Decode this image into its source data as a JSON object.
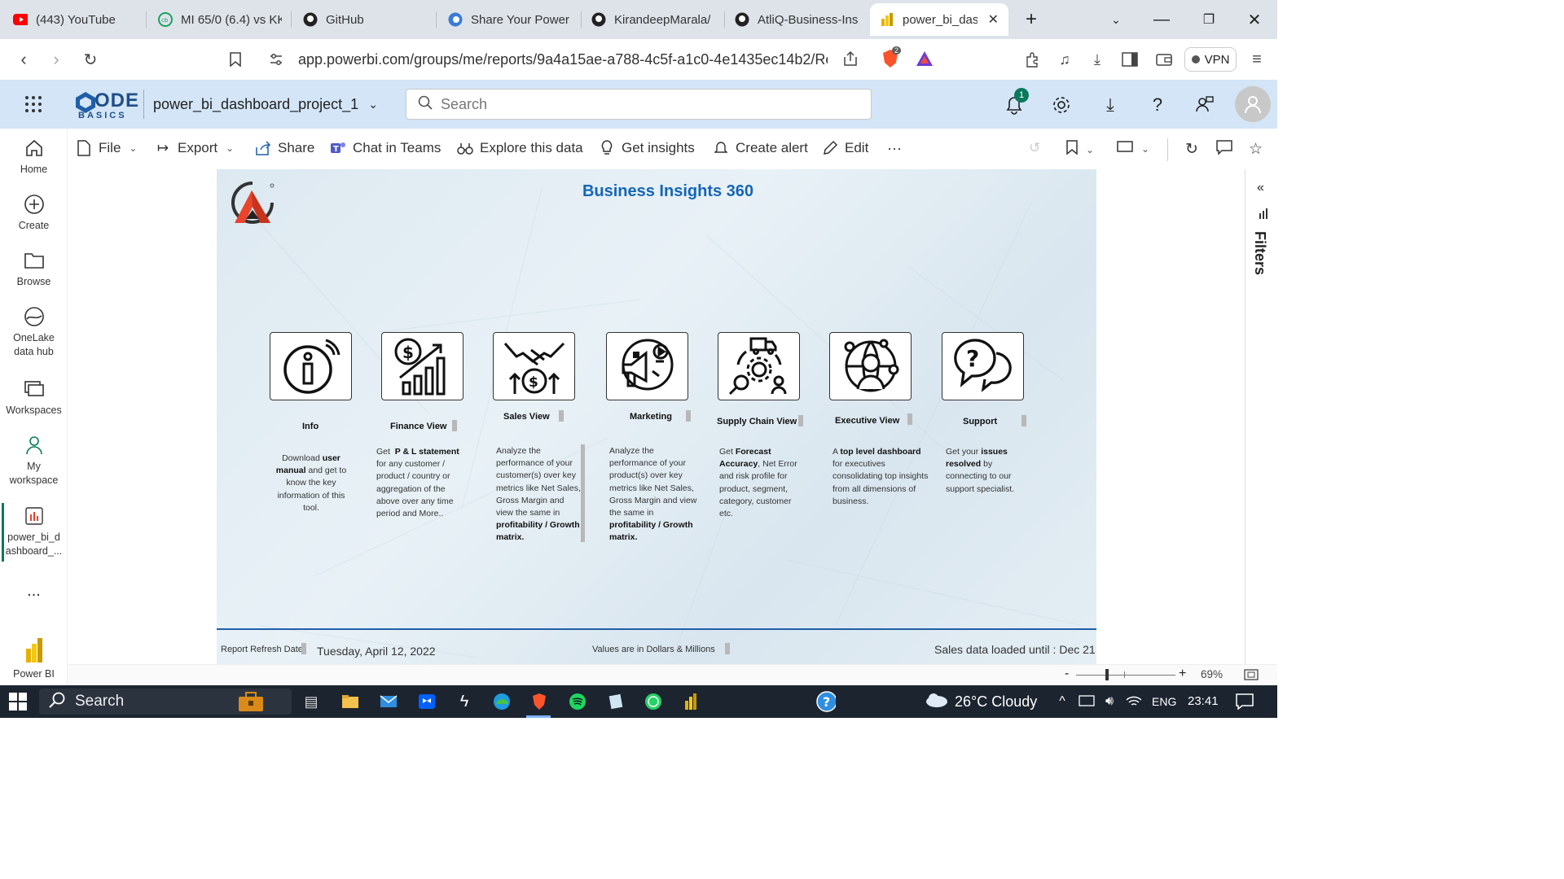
{
  "browser": {
    "tabs": [
      {
        "label": "(443) YouTube",
        "icon": "youtube-icon"
      },
      {
        "label": "MI 65/0 (6.4) vs KK",
        "icon": "cricbuzz-icon"
      },
      {
        "label": "GitHub",
        "icon": "github-icon"
      },
      {
        "label": "Share Your Power B",
        "icon": "codebasics-icon"
      },
      {
        "label": "KirandeepMarala/",
        "icon": "github-icon"
      },
      {
        "label": "AtliQ-Business-Ins",
        "icon": "github-icon"
      },
      {
        "label": "power_bi_dasl",
        "icon": "powerbi-icon",
        "active": true
      }
    ],
    "url": "app.powerbi.com/groups/me/reports/9a4a15ae-a788-4c5f-a1c0-4e1435ec14b2/Rep...",
    "shield_badge": "2",
    "vpn_label": "VPN"
  },
  "powerbi": {
    "logo_line1": "ODE",
    "logo_line2": "BASICS",
    "report_name": "power_bi_dashboard_project_1",
    "search_placeholder": "Search",
    "notification_count": "1",
    "left_nav": [
      {
        "label": "Home",
        "icon": "home-icon"
      },
      {
        "label": "Create",
        "icon": "plus-circle-icon"
      },
      {
        "label": "Browse",
        "icon": "folder-icon"
      },
      {
        "label": "OneLake data hub",
        "icon": "onelake-icon"
      },
      {
        "label": "Workspaces",
        "icon": "workspaces-icon"
      },
      {
        "label": "My workspace",
        "icon": "user-icon"
      },
      {
        "label": "power_bi_d ashboard_...",
        "icon": "report-icon"
      },
      {
        "label": "...",
        "icon": "more-icon"
      },
      {
        "label": "Power BI",
        "icon": "powerbi-icon"
      }
    ],
    "toolbar": {
      "file": "File",
      "export": "Export",
      "share": "Share",
      "chat": "Chat in Teams",
      "explore": "Explore this data",
      "insights": "Get insights",
      "alert": "Create alert",
      "edit": "Edit",
      "more": "···"
    },
    "filters_label": "Filters",
    "zoom": "69%"
  },
  "report": {
    "title": "Business Insights 360",
    "cards": [
      {
        "title": "Info",
        "icon": "info-icon",
        "desc_html": "Download <b>user manual</b> and get to know the key information of this tool."
      },
      {
        "title": "Finance View",
        "icon": "finance-icon",
        "desc_html": "Get &nbsp;<b>P &amp; L statement</b> for any customer / product / country or aggregation of the above over any time period and More.."
      },
      {
        "title": "Sales View",
        "icon": "handshake-icon",
        "desc_html": "Analyze the performance of your customer(s) over key metrics like Net Sales, Gross Margin and view the same in <b>profitability / Growth matrix.</b>"
      },
      {
        "title": "Marketing",
        "icon": "megaphone-icon",
        "desc_html": "Analyze the performance of your product(s) over key metrics like Net Sales, Gross Margin and view the same in <b>profitability / Growth matrix.</b>"
      },
      {
        "title": "Supply Chain View",
        "icon": "supply-chain-icon",
        "desc_html": "Get <b>Forecast Accuracy</b>, Net Error and risk profile for product, segment, category, customer etc."
      },
      {
        "title": "Executive View",
        "icon": "executive-icon",
        "desc_html": "A <b>top level dashboard</b> for executives consolidating top insights from all dimensions of business."
      },
      {
        "title": "Support",
        "icon": "support-icon",
        "desc_html": "Get your <b>issues resolved</b> by connecting to our support specialist."
      }
    ],
    "footer": {
      "refresh_label": "Report Refresh Date",
      "refresh_date": "Tuesday, April 12, 2022",
      "values_note": "Values are in Dollars & Millions",
      "loaded": "Sales data loaded until : Dec 21"
    },
    "colors": {
      "title": "#1565b8",
      "footer_line": "#1f5fa8",
      "logo_red": "#e8452c"
    }
  },
  "taskbar": {
    "search": "Search",
    "weather": "26°C  Cloudy",
    "lang": "ENG",
    "time": "23:41"
  }
}
